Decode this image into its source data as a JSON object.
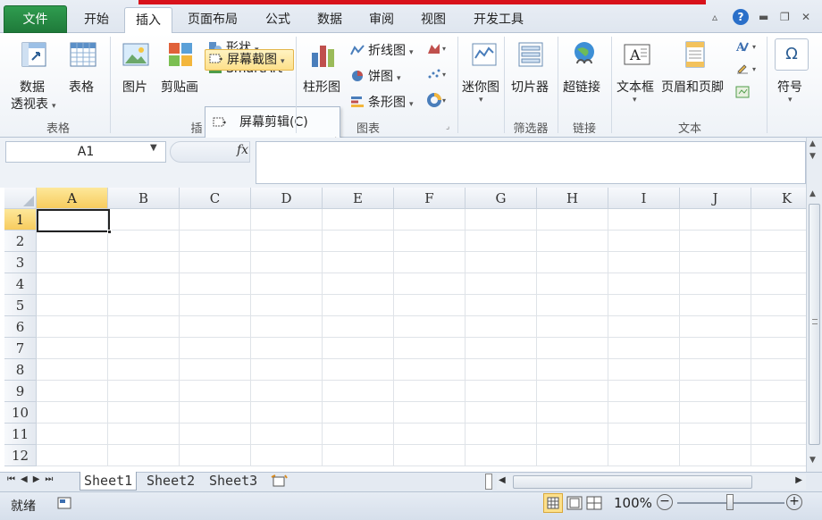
{
  "tabs": {
    "file": "文件",
    "home": "开始",
    "insert": "插入",
    "layout": "页面布局",
    "formulas": "公式",
    "data": "数据",
    "review": "审阅",
    "view": "视图",
    "developer": "开发工具"
  },
  "ribbon": {
    "tables": {
      "pivot_line1": "数据",
      "pivot_line2": "透视表",
      "table": "表格",
      "group": "表格"
    },
    "illustrations": {
      "picture": "图片",
      "clipart": "剪贴画",
      "shapes": "形状",
      "smartart": "SmartArt",
      "screenshot": "屏幕截图",
      "group": "插"
    },
    "charts": {
      "column": "柱形图",
      "line": "折线图",
      "pie": "饼图",
      "bar": "条形图",
      "group": "图表"
    },
    "sparklines": {
      "label": "迷你图"
    },
    "filter": {
      "slicer": "切片器",
      "group": "筛选器"
    },
    "links": {
      "hyperlink": "超链接",
      "group": "链接"
    },
    "text": {
      "textbox": "文本框",
      "header_footer": "页眉和页脚",
      "group": "文本"
    },
    "symbols": {
      "symbol": "符号"
    }
  },
  "dropdown": {
    "screen_clip": "屏幕剪辑(C)"
  },
  "formula_bar": {
    "name_box": "A1",
    "fx": "fx"
  },
  "columns": [
    "A",
    "B",
    "C",
    "D",
    "E",
    "F",
    "G",
    "H",
    "I",
    "J",
    "K"
  ],
  "rows": [
    "1",
    "2",
    "3",
    "4",
    "5",
    "6",
    "7",
    "8",
    "9",
    "10",
    "11",
    "12"
  ],
  "sheets": [
    "Sheet1",
    "Sheet2",
    "Sheet3"
  ],
  "status": {
    "ready": "就绪",
    "zoom": "100%"
  },
  "colors": {
    "file_tab": "#1f7a3a",
    "accent_red": "#d8121b",
    "selection": "#f7cc5e"
  }
}
